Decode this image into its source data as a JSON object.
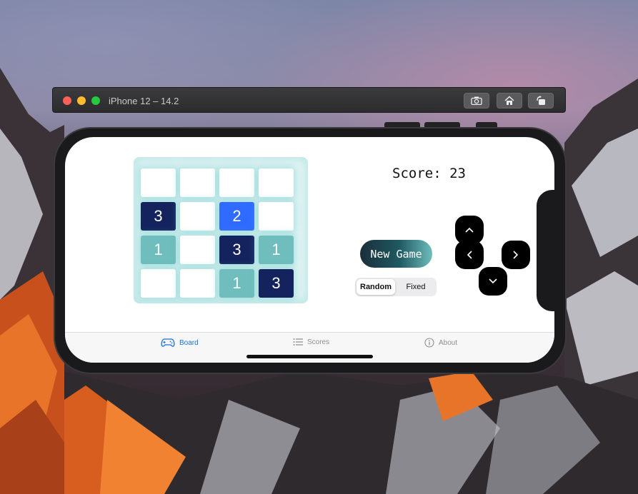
{
  "simulator": {
    "title": "iPhone 12 – 14.2",
    "buttons": [
      "screenshot-icon",
      "home-icon",
      "rotate-icon"
    ]
  },
  "game": {
    "board": [
      [
        "",
        "",
        "",
        ""
      ],
      [
        "3",
        "",
        "2",
        ""
      ],
      [
        "1",
        "",
        "3",
        "1"
      ],
      [
        "",
        "",
        "1",
        "3"
      ]
    ],
    "score_text": "Score: 23",
    "new_game_label": "New Game",
    "mode_options": [
      "Random",
      "Fixed"
    ],
    "selected_mode": "Random",
    "colors": {
      "tile_3": "#14235e",
      "tile_2": "#2f6bff",
      "tile_1": "#6fbdbd",
      "empty": "#ffffff"
    },
    "dpad": [
      "up",
      "left",
      "right",
      "down"
    ]
  },
  "tabbar": {
    "tabs": [
      {
        "label": "Board",
        "icon": "gamecontroller-icon",
        "active": true
      },
      {
        "label": "Scores",
        "icon": "list-icon",
        "active": false
      },
      {
        "label": "About",
        "icon": "info-icon",
        "active": false
      }
    ],
    "accent": "#1c6fd8"
  }
}
